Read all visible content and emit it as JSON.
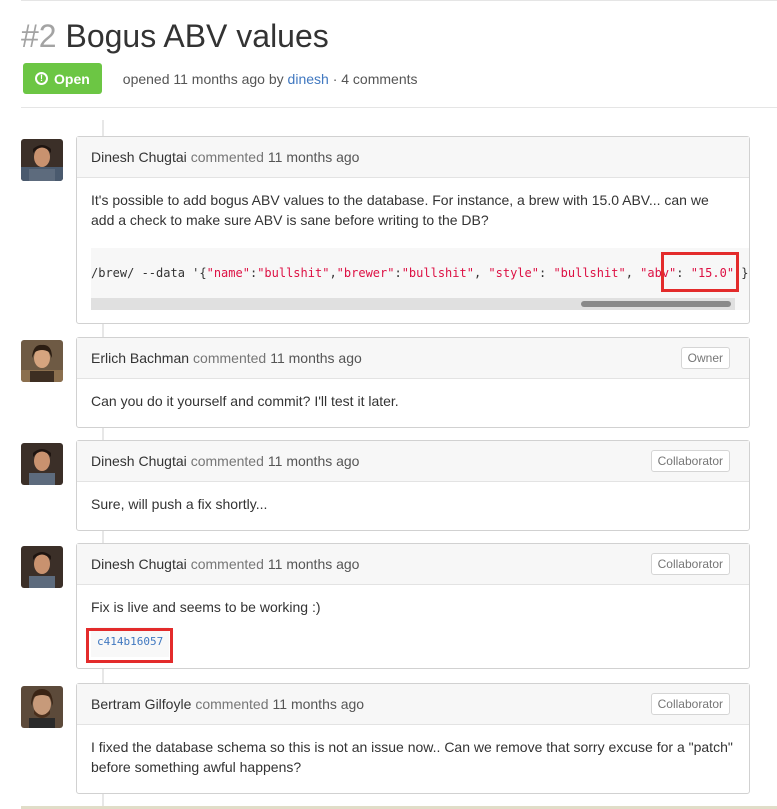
{
  "issue": {
    "number": "#2",
    "title": "Bogus ABV values",
    "state_label": "Open",
    "state_icon": "alert-icon",
    "meta_prefix": "opened 11 months ago by",
    "meta_author": "dinesh",
    "meta_suffix": "· 4 comments"
  },
  "comments": [
    {
      "author": "Dinesh Chugtai",
      "action": "commented",
      "time": "11 months ago",
      "badge": "",
      "body": "It's possible to add bogus ABV values to the database. For instance, a brew with 15.0 ABV... can we add a check to make sure ABV is sane before writing to the DB?",
      "code": {
        "prefix": "/brew/ --data '{",
        "k1": "\"name\"",
        "v1": "\"bullshit\"",
        "k2": "\"brewer\"",
        "v2": "\"bullshit\"",
        "k3": "\"style\"",
        "v3": "\"bullshit\"",
        "k4": "\"abv\"",
        "v4": "\"15.0\"",
        "suffix": ")}'"
      }
    },
    {
      "author": "Erlich Bachman",
      "action": "commented",
      "time": "11 months ago",
      "badge": "Owner",
      "body": "Can you do it yourself and commit? I'll test it later."
    },
    {
      "author": "Dinesh Chugtai",
      "action": "commented",
      "time": "11 months ago",
      "badge": "Collaborator",
      "body": "Sure, will push a fix shortly..."
    },
    {
      "author": "Dinesh Chugtai",
      "action": "commented",
      "time": "11 months ago",
      "badge": "Collaborator",
      "body": "Fix is live and seems to be working :)",
      "commit_sha": "c414b16057"
    },
    {
      "author": "Bertram Gilfoyle",
      "action": "commented",
      "time": "11 months ago",
      "badge": "Collaborator",
      "body": "I fixed the database schema so this is not an issue now.. Can we remove that sorry excuse for a \"patch\" before something awful happens?"
    }
  ],
  "colors": {
    "open_green": "#6cc644",
    "link_blue": "#4078c0",
    "highlight_red": "#e32b2b",
    "string_red": "#dd1144"
  }
}
